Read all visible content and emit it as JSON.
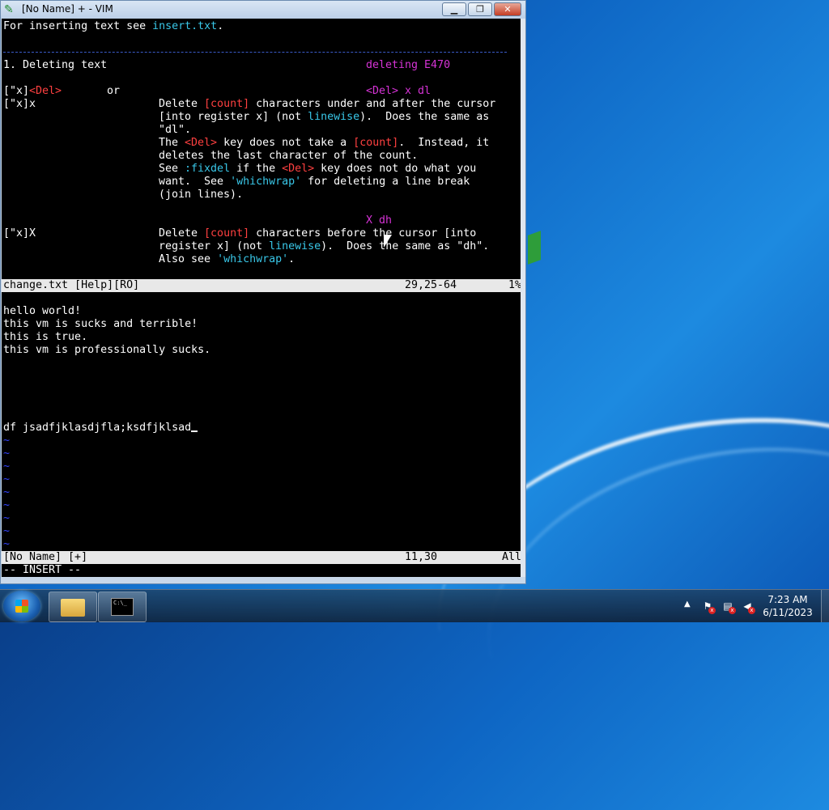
{
  "window": {
    "title": "[No Name] + - VIM",
    "minimize_label": "▁",
    "maximize_label": "❐",
    "close_label": "✕"
  },
  "help": {
    "line1_prefix": "For inserting text see ",
    "line1_link": "insert.txt",
    "line1_suffix": ".",
    "section_title": "1. Deleting text",
    "tag_deleting": "deleting E470",
    "cmd_x_del_a": "[\"x]",
    "cmd_x_del_b": "<Del>",
    "cmd_or": "or",
    "tag_del_x_dl": "<Del> x dl",
    "cmd_x_x": "[\"x]x",
    "d1_a": "Delete ",
    "d1_b": "[count]",
    "d1_c": " characters under and after the cursor",
    "d2_a": "[into register x] (not ",
    "d2_b": "linewise",
    "d2_c": ").  Does the same as",
    "d3": "\"dl\".",
    "d4_a": "The ",
    "d4_b": "<Del>",
    "d4_c": " key does not take a ",
    "d4_d": "[count]",
    "d4_e": ".  Instead, it",
    "d5": "deletes the last character of the count.",
    "d6_a": "See ",
    "d6_b": ":fixdel",
    "d6_c": " if the ",
    "d6_d": "<Del>",
    "d6_e": " key does not do what you",
    "d7_a": "want.  See ",
    "d7_b": "'whichwrap'",
    "d7_c": " for deleting a line break",
    "d8": "(join lines).",
    "tag_X_dh": "X dh",
    "cmd_X": "[\"x]X",
    "e1_a": "Delete ",
    "e1_b": "[count]",
    "e1_c": " characters before the cursor [into",
    "e2_a": "register x] (not ",
    "e2_b": "linewise",
    "e2_c": ").  Does the same as \"dh\".",
    "e3_a": "Also see ",
    "e3_b": "'whichwrap'",
    "e3_c": "."
  },
  "status_top": {
    "file": "change.txt [Help][RO]",
    "position": "29,25-64",
    "percent": "1%"
  },
  "buffer": {
    "lines": [
      "hello world!",
      "this vm is sucks and terrible!",
      "this is true.",
      "this vm is professionally sucks.",
      "",
      "",
      "",
      "",
      "",
      "df jsadfjklasdjfla;ksdfjklsad"
    ],
    "tilde": "~"
  },
  "status_bottom": {
    "file": "[No Name] [+]",
    "position": "11,30",
    "percent": "All"
  },
  "mode": "-- INSERT --",
  "taskbar": {
    "cmd_icon_text": "C:\\_",
    "tray_arrow": "▲",
    "time": "7:23 AM",
    "date": "6/11/2023"
  }
}
